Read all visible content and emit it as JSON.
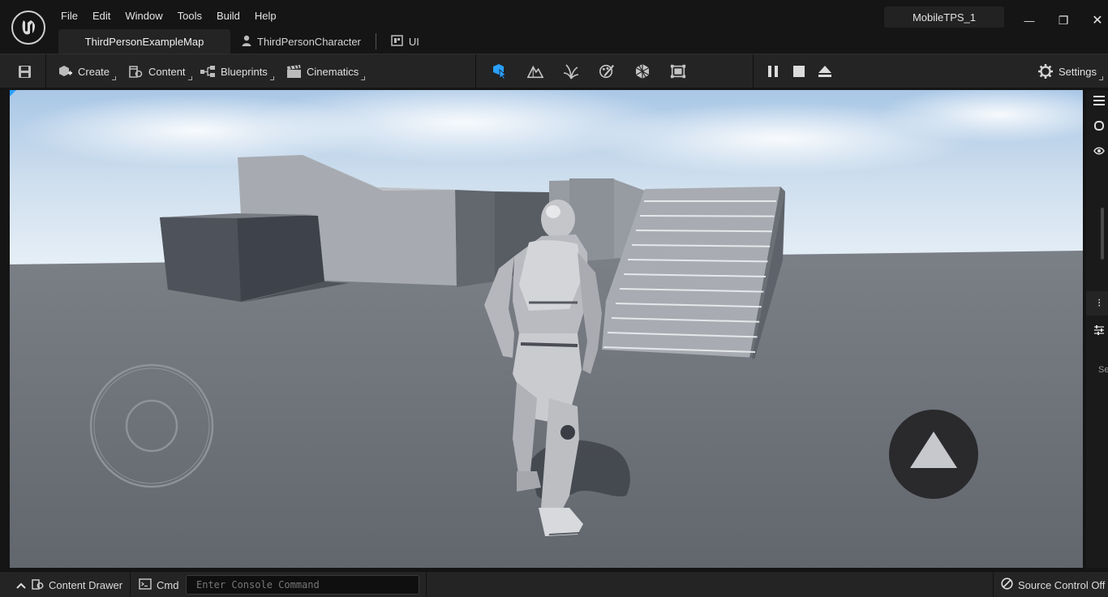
{
  "menu": [
    "File",
    "Edit",
    "Window",
    "Tools",
    "Build",
    "Help"
  ],
  "tabs": [
    {
      "label": "ThirdPersonExampleMap",
      "active": true
    },
    {
      "label": "ThirdPersonCharacter",
      "icon": "character-icon"
    },
    {
      "label": "UI",
      "icon": "widget-icon"
    }
  ],
  "project_name": "MobileTPS_1",
  "window_controls": {
    "minimize": "—",
    "restore": "❐",
    "close": "✕"
  },
  "toolbar": {
    "create": "Create",
    "content": "Content",
    "blueprints": "Blueprints",
    "cinematics": "Cinematics",
    "settings": "Settings",
    "mode_icons": [
      "select-mode-icon",
      "landscape-mode-icon",
      "foliage-mode-icon",
      "mesh-paint-mode-icon",
      "fracture-mode-icon",
      "modeling-mode-icon"
    ],
    "play_icons": [
      "pause-icon",
      "stop-icon",
      "eject-icon"
    ]
  },
  "status": {
    "content_drawer": "Content Drawer",
    "cmd": "Cmd",
    "console_placeholder": "Enter Console Command",
    "source_control": "Source Control Off"
  },
  "right_strip": {
    "partial_label": "Se"
  },
  "colors": {
    "accent": "#2aa0ff",
    "background": "#151515",
    "toolbar": "#242424"
  }
}
